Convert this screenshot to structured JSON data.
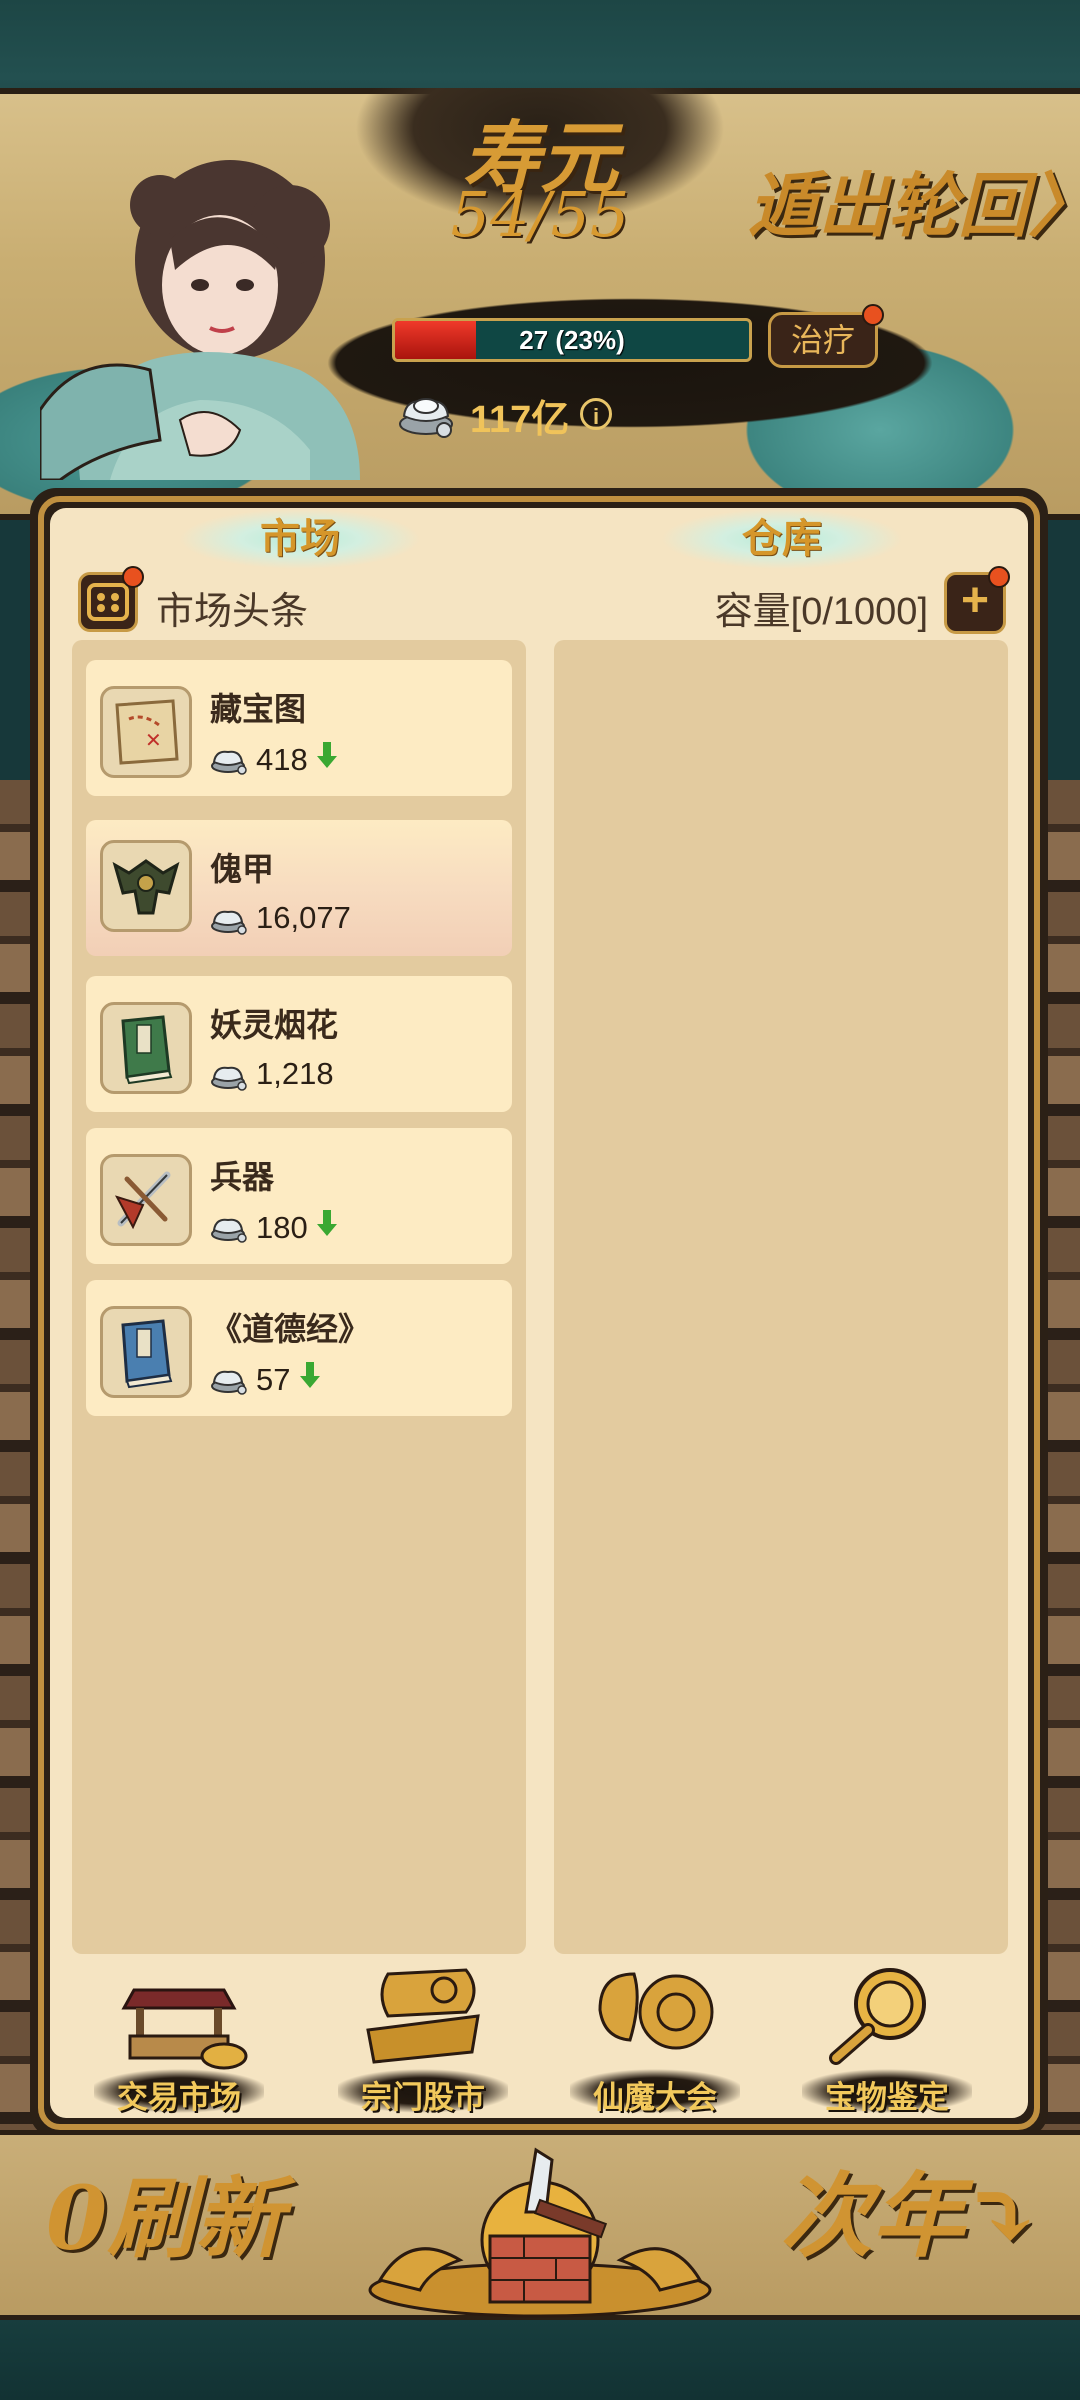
{
  "header": {
    "lifespan_label": "寿元",
    "lifespan_value": "54/55",
    "escape_label": "遁出轮回〉",
    "hp_text": "27 (23%)",
    "hp_fraction": 0.23,
    "heal_label": "治疗",
    "silver_amount": "117亿",
    "info_icon": "ⓘ"
  },
  "tabs": {
    "market": "市场",
    "warehouse": "仓库"
  },
  "market": {
    "headline_label": "市场头条",
    "items": [
      {
        "name": "藏宝图",
        "price": "418",
        "trend": "down",
        "icon": "treasure-map-icon"
      },
      {
        "name": "傀甲",
        "price": "16,077",
        "trend": "none",
        "icon": "puppet-armor-icon"
      },
      {
        "name": "妖灵烟花",
        "price": "1,218",
        "trend": "none",
        "icon": "green-book-icon"
      },
      {
        "name": "兵器",
        "price": "180",
        "trend": "down",
        "icon": "weapons-icon"
      },
      {
        "name": "《道德经》",
        "price": "57",
        "trend": "down",
        "icon": "blue-book-icon"
      }
    ]
  },
  "warehouse": {
    "capacity_label": "容量[0/1000]"
  },
  "nav": [
    {
      "label": "交易市场",
      "icon": "market-stall-icon"
    },
    {
      "label": "宗门股市",
      "icon": "sect-stock-icon"
    },
    {
      "label": "仙魔大会",
      "icon": "immortal-demon-gathering-icon"
    },
    {
      "label": "宝物鉴定",
      "icon": "magnifier-icon"
    }
  ],
  "footer": {
    "refresh_label": "0刷新",
    "next_year_label": "次年⤵"
  },
  "colors": {
    "gold": "#d5962a",
    "panel": "#f5e4c2",
    "column": "#e3cb9f",
    "card": "#fdebc3",
    "down_arrow": "#3aa832",
    "hp_red": "#e0241a"
  }
}
